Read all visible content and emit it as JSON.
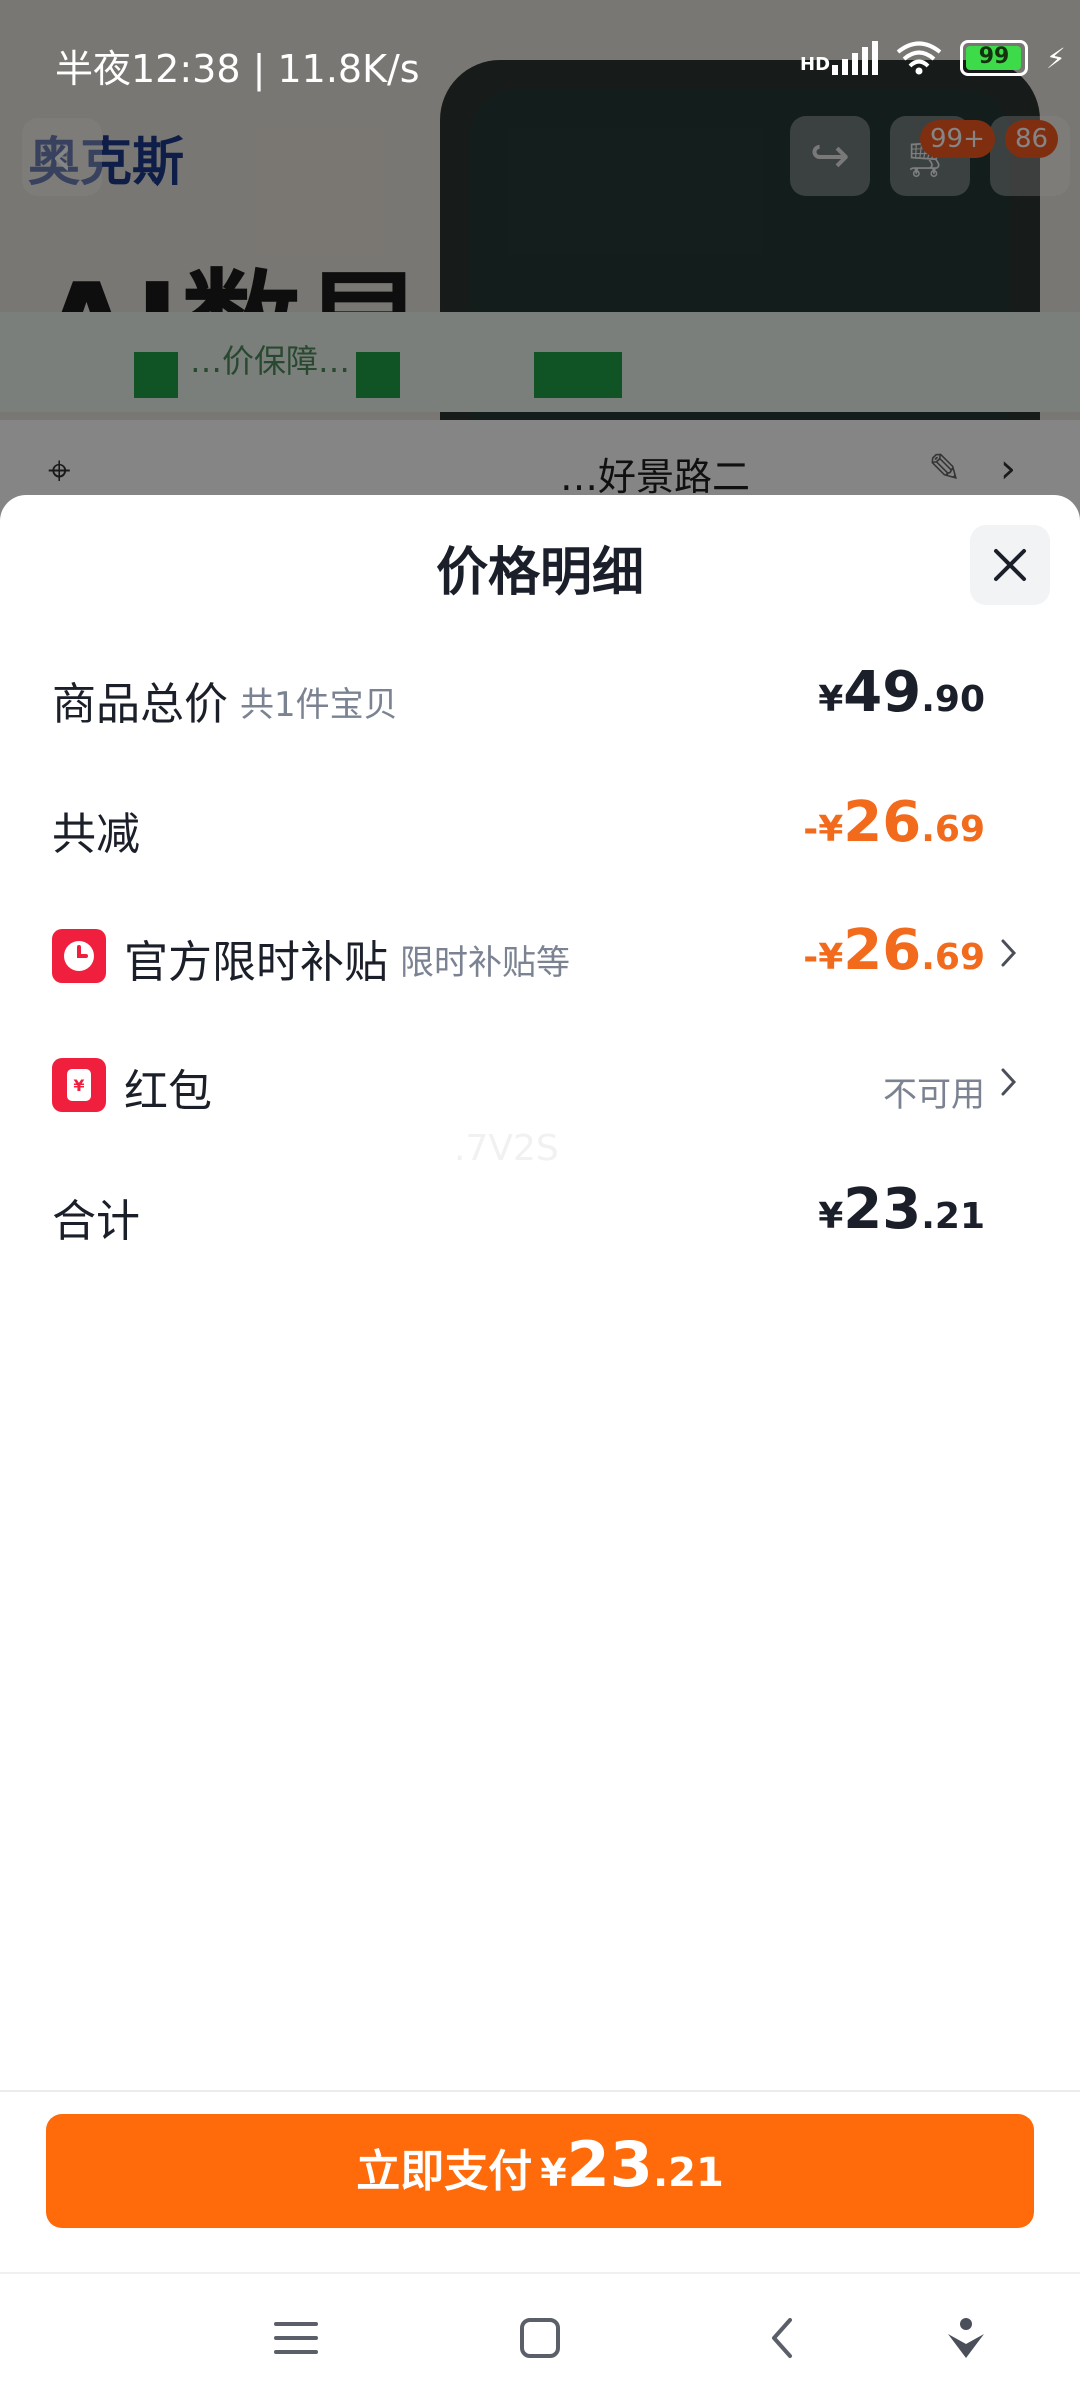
{
  "status_bar": {
    "time": "半夜12:38 | 11.8K/s",
    "network_label": "HD",
    "battery_level": "99",
    "battery_fraction": 0.99
  },
  "background": {
    "brand": "奥克斯",
    "headline": "AI数显",
    "strip_text": "…价保障…",
    "address_text": "…好景路二",
    "cart_badge": "99+",
    "more_badge": "86",
    "icons": [
      "back-icon",
      "share-icon",
      "cart-icon",
      "location-icon",
      "edit-icon",
      "chevron-right-icon"
    ]
  },
  "sheet": {
    "title": "价格明细",
    "rows": [
      {
        "label": "商品总价",
        "sub": "共1件宝贝",
        "currency": "¥",
        "int": "49",
        "dec": ".90"
      },
      {
        "label": "共减",
        "currency": "-¥",
        "int": "26",
        "dec": ".69"
      },
      {
        "label": "官方限时补贴",
        "sub": "限时补贴等",
        "currency": "-¥",
        "int": "26",
        "dec": ".69",
        "icon": "clock-icon"
      },
      {
        "label": "红包",
        "value_text": "不可用",
        "icon": "yuan-icon"
      },
      {
        "label": "合计",
        "currency": "¥",
        "int": "23",
        "dec": ".21"
      }
    ],
    "watermark": ".7V2S"
  },
  "pay_button": {
    "label": "立即支付",
    "currency": "¥",
    "int": "23",
    "dec": ".21"
  },
  "nav_bar": {
    "icons": [
      "menu-icon",
      "home-icon",
      "back-icon",
      "assistant-icon"
    ]
  },
  "colors": {
    "accent": "#ff6a0a",
    "discount": "#f26a1b",
    "icon_red": "#f01f3d"
  }
}
